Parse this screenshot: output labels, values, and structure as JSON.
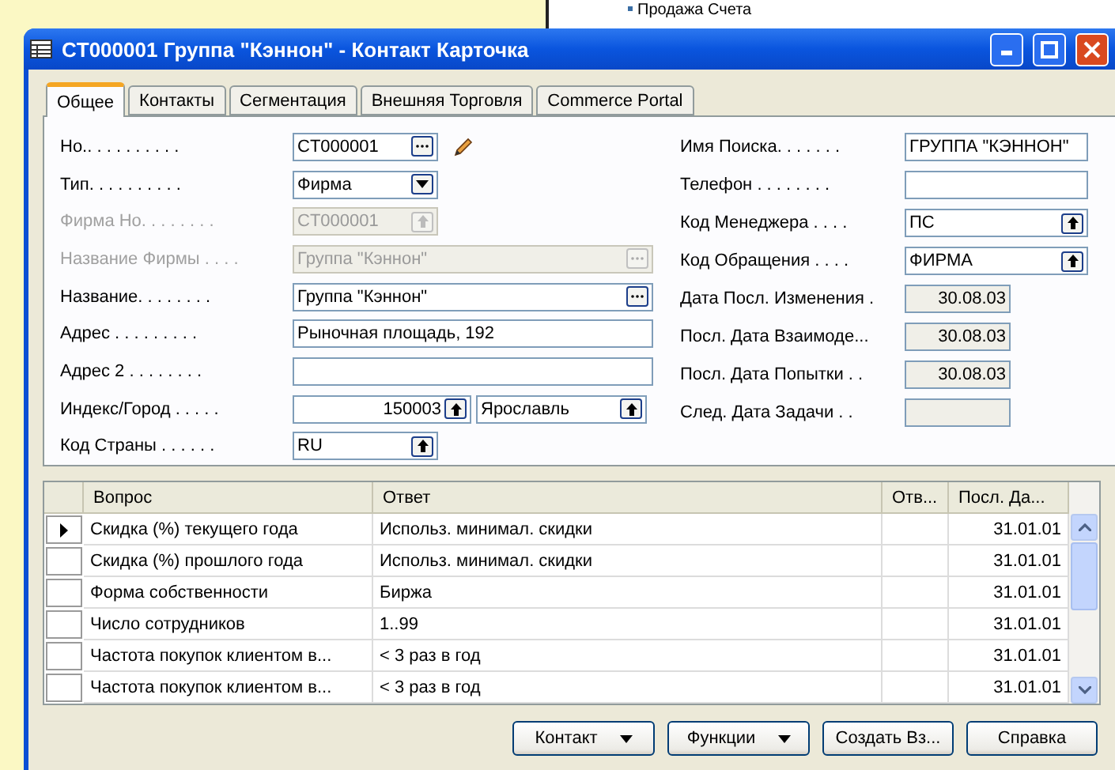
{
  "background_window": {
    "item": "Продажа Счета"
  },
  "window": {
    "title": "CT000001 Группа \"Кэннон\" - Контакт Карточка"
  },
  "tabs": [
    {
      "label": "Общее",
      "selected": true
    },
    {
      "label": "Контакты",
      "selected": false
    },
    {
      "label": "Сегментация",
      "selected": false
    },
    {
      "label": "Внешняя Торговля",
      "selected": false
    },
    {
      "label": "Commerce Portal",
      "selected": false
    }
  ],
  "left_fields": [
    {
      "label": "Но.. . . . . . . . . .",
      "value": "CT000001",
      "kind": "ellipsis",
      "wide": false,
      "disabled": false,
      "edit_icon": true
    },
    {
      "label": "Тип. . . . . . . . . .",
      "value": "Фирма",
      "kind": "dropdown",
      "wide": false,
      "disabled": false
    },
    {
      "label": "Фирма Но. . . . . . . .",
      "value": "CT000001",
      "kind": "lookup",
      "wide": false,
      "disabled": true
    },
    {
      "label": "Название Фирмы . . . .",
      "value": "Группа \"Кэннон\"",
      "kind": "ellipsis",
      "wide": true,
      "disabled": true
    },
    {
      "label": "Название. . . . . . . .",
      "value": "Группа \"Кэннон\"",
      "kind": "ellipsis",
      "wide": true,
      "disabled": false
    },
    {
      "label": "Адрес . . . . . . . . .",
      "value": "Рыночная площадь, 192",
      "kind": "text",
      "wide": true,
      "disabled": false
    },
    {
      "label": "Адрес 2 . . . . . . . .",
      "kind": "text",
      "wide": true,
      "disabled": false
    },
    {
      "label": "Индекс/Город . . . . .",
      "value": "150003",
      "city": "Ярославль",
      "kind": "postcode",
      "disabled": false
    },
    {
      "label": "Код Страны . . . . . .",
      "value": "RU",
      "kind": "lookup",
      "wide": false,
      "disabled": false
    }
  ],
  "right_fields": [
    {
      "label": "Имя Поиска. . . . . . .",
      "value": "ГРУППА \"КЭННОН\"",
      "kind": "text"
    },
    {
      "label": "Телефон . . . . . . . .",
      "kind": "text"
    },
    {
      "label": "Код Менеджера . . . .",
      "value": "ПС",
      "kind": "lookup"
    },
    {
      "label": "Код Обращения . . . .",
      "value": "ФИРМА",
      "kind": "lookup"
    },
    {
      "label": "Дата Посл. Изменения .",
      "value": "30.08.03",
      "kind": "readonly"
    },
    {
      "label": "Посл. Дата Взаимоде...",
      "value": "30.08.03",
      "kind": "readonly"
    },
    {
      "label": "Посл. Дата Попытки . .",
      "value": "30.08.03",
      "kind": "readonly"
    },
    {
      "label": "След. Дата Задачи . .",
      "kind": "readonly"
    }
  ],
  "table": {
    "columns": [
      "Вопрос",
      "Ответ",
      "Отв...",
      "Посл. Да..."
    ],
    "rows": [
      {
        "selected": true,
        "cells": [
          "Скидка (%) текущего года",
          "Использ. минимал. скидки",
          "",
          "31.01.01"
        ]
      },
      {
        "selected": false,
        "cells": [
          "Скидка (%) прошлого года",
          "Использ. минимал. скидки",
          "",
          "31.01.01"
        ]
      },
      {
        "selected": false,
        "cells": [
          "Форма собственности",
          "Биржа",
          "",
          "31.01.01"
        ]
      },
      {
        "selected": false,
        "cells": [
          "Число сотрудников",
          "1..99",
          "",
          "31.01.01"
        ]
      },
      {
        "selected": false,
        "cells": [
          "Частота покупок клиентом в...",
          "< 3 раз в год",
          "",
          "31.01.01"
        ]
      },
      {
        "selected": false,
        "cells": [
          "Частота покупок клиентом в...",
          "< 3 раз в год",
          "",
          "31.01.01"
        ]
      }
    ]
  },
  "buttons": [
    {
      "label": "Контакт",
      "kind": "menu"
    },
    {
      "label": "Функции",
      "kind": "menu"
    },
    {
      "label": "Создать Вз...",
      "kind": "plain"
    },
    {
      "label": "Справка",
      "kind": "plain"
    }
  ]
}
